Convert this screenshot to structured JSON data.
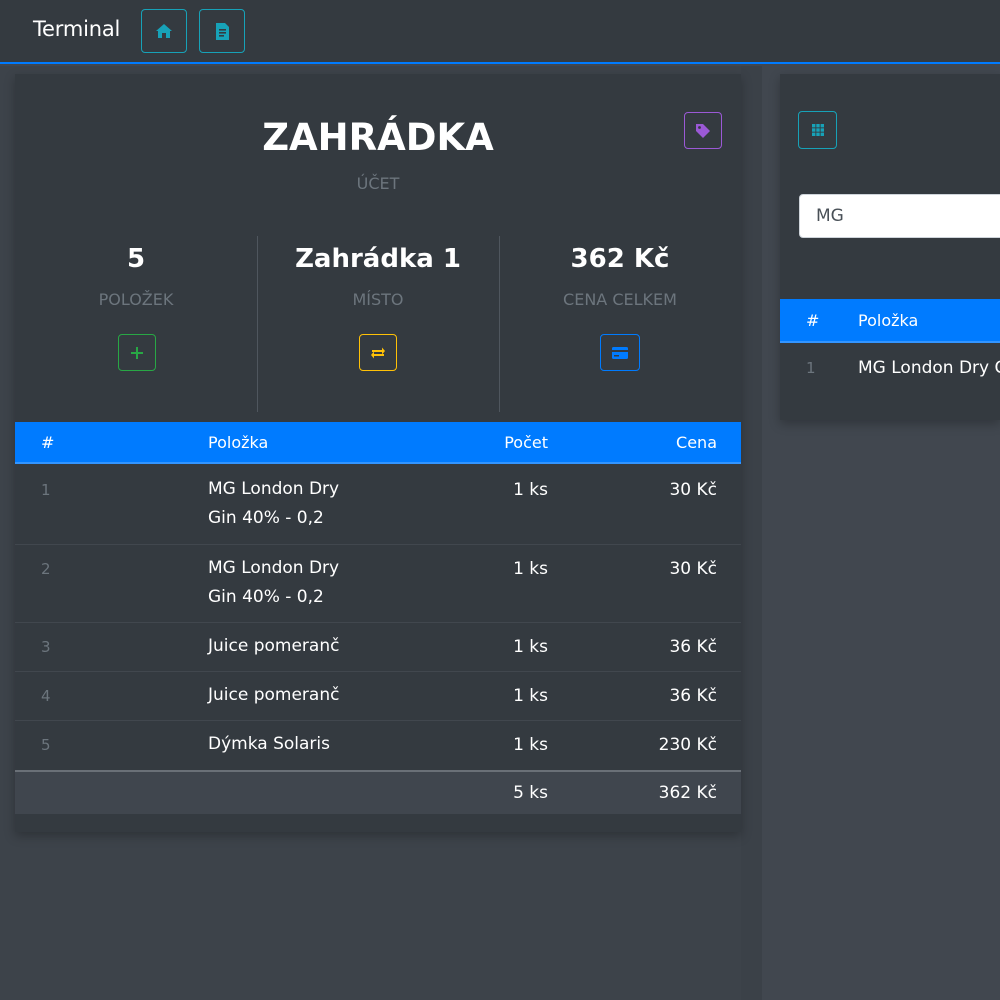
{
  "navbar": {
    "brand": "Terminal",
    "home_icon": "home-icon",
    "receipt_icon": "receipt-icon"
  },
  "account": {
    "title": "ZAHRÁDKA",
    "subtitle": "ÚČET",
    "tag_icon": "tag-icon",
    "stats": [
      {
        "value": "5",
        "label": "POLOŽEK",
        "button_icon": "plus-icon",
        "color": "#28a745"
      },
      {
        "value": "Zahrádka 1",
        "label": "MÍSTO",
        "button_icon": "swap-icon",
        "color": "#ffc107"
      },
      {
        "value": "362 Kč",
        "label": "CENA CELKEM",
        "button_icon": "credit-card-icon",
        "color": "#007bff"
      }
    ]
  },
  "order_table": {
    "headers": {
      "index": "#",
      "item": "Položka",
      "qty": "Počet",
      "price": "Cena"
    },
    "rows": [
      {
        "index": "1",
        "name_line1": "MG London Dry",
        "name_line2": "Gin 40% - 0,2",
        "qty": "1 ks",
        "price": "30 Kč"
      },
      {
        "index": "2",
        "name_line1": "MG London Dry",
        "name_line2": "Gin 40% - 0,2",
        "qty": "1 ks",
        "price": "30 Kč"
      },
      {
        "index": "3",
        "name_line1": "Juice pomeranč",
        "name_line2": "",
        "qty": "1 ks",
        "price": "36 Kč"
      },
      {
        "index": "4",
        "name_line1": "Juice pomeranč",
        "name_line2": "",
        "qty": "1 ks",
        "price": "36 Kč"
      },
      {
        "index": "5",
        "name_line1": "Dýmka Solaris",
        "name_line2": "",
        "qty": "1 ks",
        "price": "230 Kč"
      }
    ],
    "footer": {
      "qty": "5 ks",
      "price": "362 Kč"
    }
  },
  "product_search": {
    "grid_icon": "grid-icon",
    "search_value": "MG",
    "headers": {
      "index": "#",
      "item": "Položka"
    },
    "rows": [
      {
        "index": "1",
        "name": "MG London Dry Gin"
      }
    ]
  },
  "colors": {
    "primary": "#007bff",
    "info": "#17a2b8",
    "purple": "#9b59d6",
    "dark": "#343a40"
  }
}
